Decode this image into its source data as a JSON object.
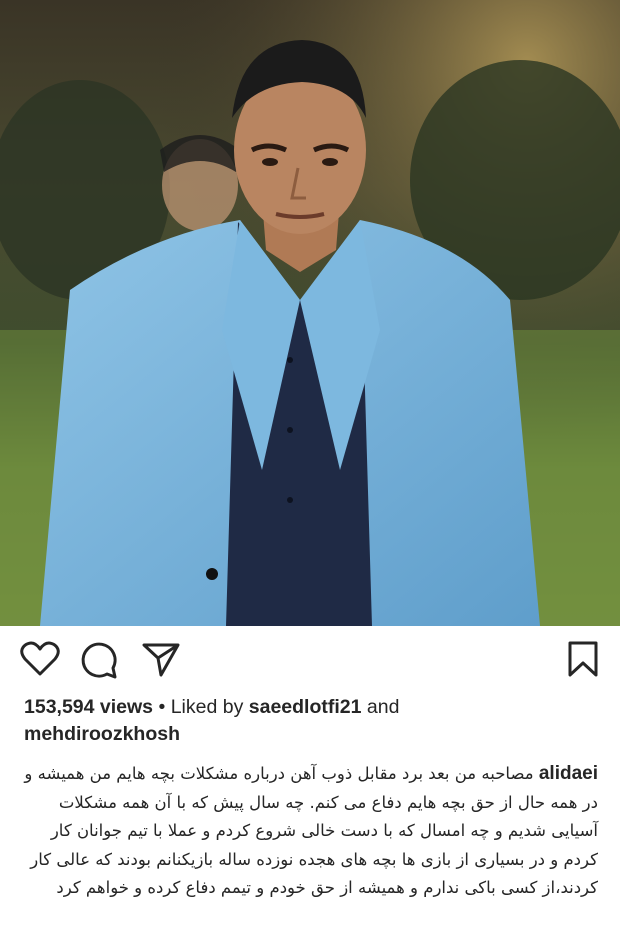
{
  "post": {
    "image_alt": "photo",
    "views": "153,594 views",
    "separator": " • ",
    "liked_by_prefix": "Liked by ",
    "liked_by_user": "saeedlotfi21",
    "and": " and",
    "second_user": "mehdiroozkhosh",
    "caption_user": "alidaei",
    "caption_text": "مصاحبه من بعد برد مقابل ذوب آهن درباره  مشکلات بچه هایم من همیشه و در همه حال از حق بچه هایم دفاع می کنم. چه سال پیش که با آن همه مشکلات آسیایی شدیم و چه امسال که با دست خالی شروع کردم و عملا با تیم جوانان کار کردم و در بسیاری از بازی ها بچه های هجده نوزده ساله بازیکنانم بودند که عالی کار کردند،از کسی باکی ندارم و همیشه از حق خودم و تیمم دفاع کرده و خواهم کرد"
  },
  "icons": {
    "like": "heart-icon",
    "comment": "comment-icon",
    "share": "send-icon",
    "save": "bookmark-icon"
  },
  "colors": {
    "text": "#262626",
    "icon": "#262626"
  }
}
